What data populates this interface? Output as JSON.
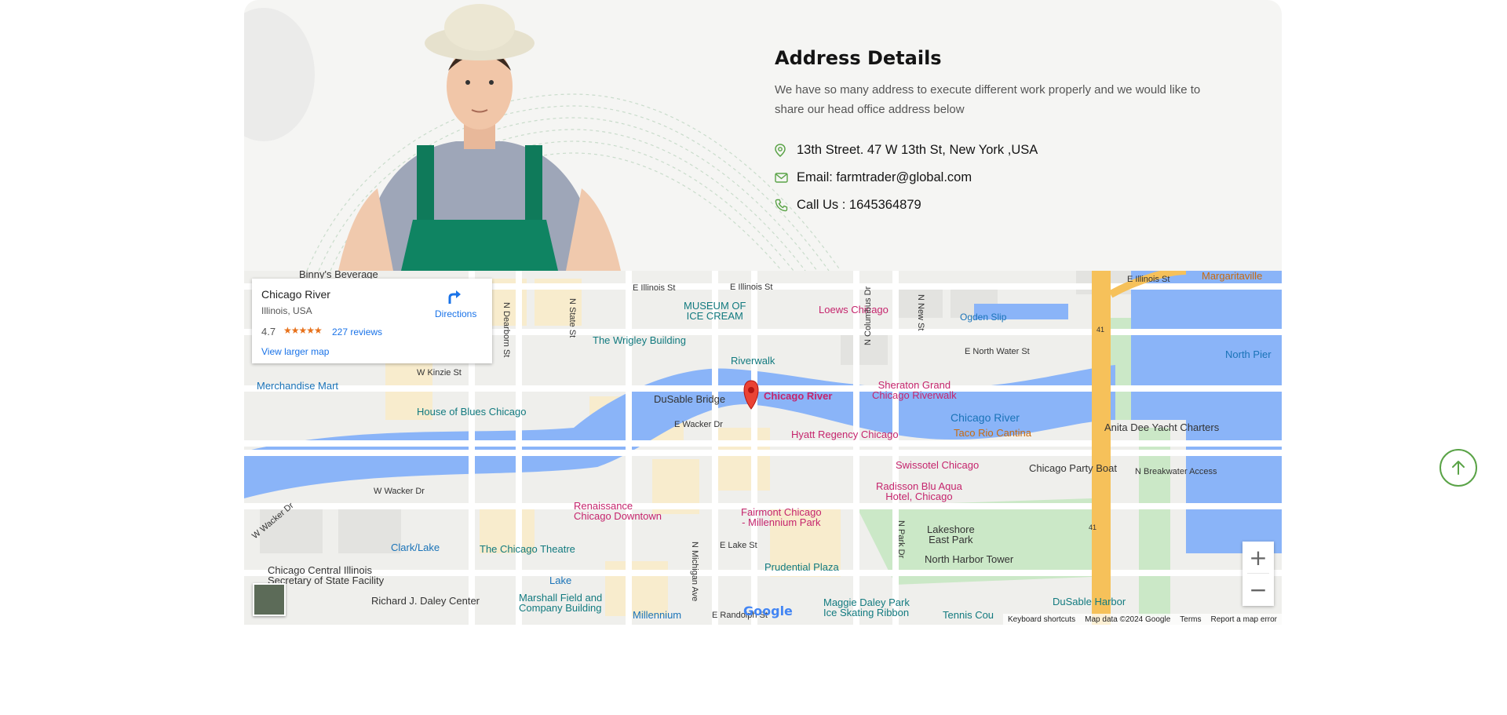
{
  "address": {
    "title": "Address Details",
    "description": "We have so many address to execute different work properly and we would like to share our head office address below",
    "street": "13th Street. 47 W 13th St, New York ,USA",
    "email": "Email: farmtrader@global.com",
    "phone": "Call Us : 1645364879"
  },
  "map": {
    "card": {
      "title": "Chicago River",
      "subtitle": "Illinois, USA",
      "rating": "4.7",
      "stars": "★★★★★",
      "reviews": "227 reviews",
      "view_larger": "View larger map",
      "directions": "Directions"
    },
    "marker_label": "Chicago River",
    "labels": {
      "binnys": "Binny's Beverage",
      "e_illinois_1": "E Illinois St",
      "e_illinois_2": "E Illinois St",
      "e_illinois_3": "E Illinois St",
      "museum": "MUSEUM OF\nICE CREAM",
      "loews": "Loews Chicago",
      "ogden": "Ogden Slip",
      "margaritaville": "Margaritaville",
      "wrigley": "The Wrigley Building",
      "n_dearborn": "N Dearborn St",
      "n_state": "N State St",
      "n_new": "N New St",
      "e_north_water": "E North Water St",
      "north_pier": "North Pier",
      "riverwalk": "Riverwalk",
      "w_kinzie": "W Kinzie St",
      "merchandise": "Merchandise Mart",
      "sheraton": "Sheraton Grand\nChicago Riverwalk",
      "n_columbus": "N Columbus Dr",
      "dusable": "DuSable Bridge",
      "house_blues": "House of Blues Chicago",
      "chicago_river_water": "Chicago River",
      "anita": "Anita Dee Yacht Charters",
      "e_wacker": "E Wacker Dr",
      "hyatt": "Hyatt Regency Chicago",
      "taco": "Taco Rio Cantina",
      "swissotel": "Swissotel Chicago",
      "party_boat": "Chicago Party Boat",
      "breakwater": "N Breakwater Access",
      "w_wacker": "W Wacker Dr",
      "w_wacker_diag": "W Wacker Dr",
      "radisson": "Radisson Blu Aqua\nHotel, Chicago",
      "renaissance": "Renaissance\nChicago Downtown",
      "fairmont": "Fairmont Chicago\n- Millennium Park",
      "n_park": "N Park Dr",
      "lakeshore": "Lakeshore\nEast Park",
      "clark_lake": "Clark/Lake",
      "chicago_theatre": "The Chicago Theatre",
      "n_michigan": "N Michigan Ave",
      "e_lake": "E Lake St",
      "prudential": "Prudential Plaza",
      "north_harbor": "North Harbor Tower",
      "central_illinois": "Chicago Central Illinois\nSecretary of State Facility",
      "lake": "Lake",
      "daley": "Richard J. Daley Center",
      "marshall": "Marshall Field and\nCompany Building",
      "millennium": "Millennium",
      "e_randolph": "E Randolph St",
      "maggie": "Maggie Daley Park\nIce Skating Ribbon",
      "tennis": "Tennis Cou",
      "dusable_harbor": "DuSable Harbor",
      "hwy_41_top": "41",
      "hwy_41_bottom": "41"
    },
    "google": "Google",
    "zoom_in": "+",
    "zoom_out": "−",
    "footer": {
      "keyboard": "Keyboard shortcuts",
      "data": "Map data ©2024 Google",
      "terms": "Terms",
      "report": "Report a map error"
    }
  },
  "colors": {
    "accent_green": "#5aa347",
    "water": "#8ab4f8",
    "park": "#c9e7c5",
    "highway": "#f6c15a"
  },
  "icons": {
    "location": "map-pin-icon",
    "email": "envelope-icon",
    "phone": "phone-icon",
    "scroll_top": "arrow-up-icon"
  }
}
